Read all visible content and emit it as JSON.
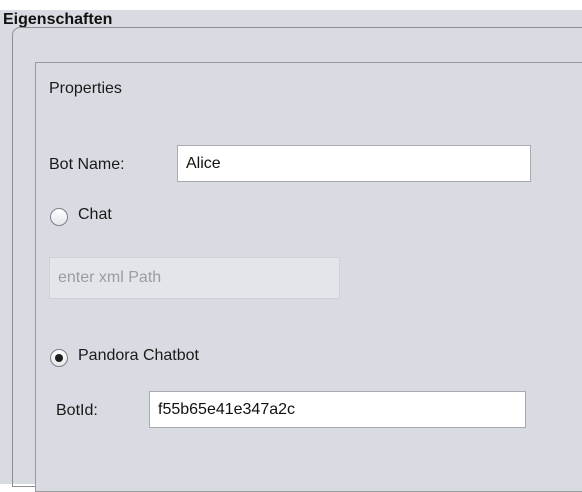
{
  "panel": {
    "title": "Eigenschaften",
    "inner_title": "Properties"
  },
  "bot_name": {
    "label": "Bot Name:",
    "value": "Alice"
  },
  "chat_option": {
    "label": "Chat",
    "selected": false
  },
  "xml_path": {
    "placeholder": "enter xml Path",
    "value": "",
    "enabled": false
  },
  "pandora_option": {
    "label": "Pandora Chatbot",
    "selected": true
  },
  "bot_id": {
    "label": "BotId:",
    "value": "f55b65e41e347a2c"
  }
}
